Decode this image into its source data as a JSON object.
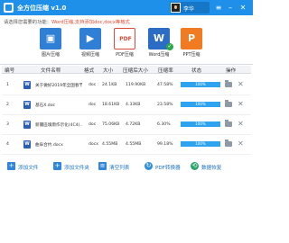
{
  "titlebar": {
    "app_title": "全方位压缩 v1.0",
    "user_name": "李华",
    "menu_icon": "menu-icon",
    "minimize_icon": "minimize-icon",
    "close_icon": "close-icon"
  },
  "tip": {
    "prefix": "请选择您需要的功能：",
    "highlight": "Word压缩,支持添加doc,docx等格式"
  },
  "tools": [
    {
      "label": "图片压缩",
      "icon": "image-compress-icon"
    },
    {
      "label": "视频压缩",
      "icon": "video-compress-icon"
    },
    {
      "label": "PDF压缩",
      "icon": "pdf-compress-icon"
    },
    {
      "label": "Word压缩",
      "icon": "word-compress-icon"
    },
    {
      "label": "PPT压缩",
      "icon": "ppt-compress-icon"
    }
  ],
  "table": {
    "headers": [
      "编号",
      "文件名称",
      "格式",
      "大小",
      "压缩后大小",
      "压缩率",
      "状态",
      "操作"
    ],
    "rows": [
      {
        "index": "1",
        "name": "关于做好2019年全国春节...",
        "format": "doc",
        "size": "24.1KB",
        "after": "119.90KB",
        "ratio": "47.58%",
        "progress": 1.0,
        "status": "100%"
      },
      {
        "index": "2",
        "name": "基石X.doc",
        "format": "doc",
        "size": "18.61KB",
        "after": "4.33KB",
        "ratio": "23.58%",
        "progress": 1.0,
        "status": "100%"
      },
      {
        "index": "3",
        "name": "新疆區塊雨作示化(4C4)...",
        "format": "doc",
        "size": "75.06KB",
        "after": "4.72KB",
        "ratio": "6.30%",
        "progress": 1.0,
        "status": "100%"
      },
      {
        "index": "4",
        "name": "曲阜合约.docx",
        "format": "docx",
        "size": "4.55MB",
        "after": "4.55MB",
        "ratio": "99.18%",
        "progress": 1.0,
        "status": "100%"
      }
    ]
  },
  "bottom": [
    {
      "label": "添加文件",
      "icon": "add-file-icon"
    },
    {
      "label": "添加文件夹",
      "icon": "add-folder-icon"
    },
    {
      "label": "清空列表",
      "icon": "clear-list-icon"
    },
    {
      "label": "PDF转换器",
      "icon": "pdf-converter-icon"
    },
    {
      "label": "数据恢复",
      "icon": "data-recovery-icon"
    }
  ]
}
